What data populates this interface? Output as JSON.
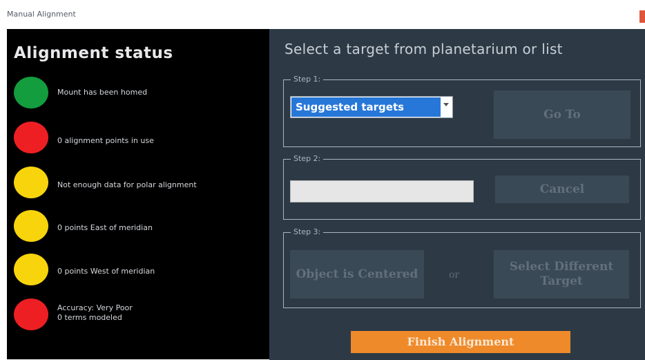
{
  "window": {
    "title": "Manual Alignment"
  },
  "status_panel": {
    "heading": "Alignment status",
    "items": [
      {
        "color": "#139d3f",
        "text": "Mount has been homed"
      },
      {
        "color": "#ee1f23",
        "text": "0 alignment points in use"
      },
      {
        "color": "#f7d40c",
        "text": "Not enough data for polar alignment"
      },
      {
        "color": "#f7d40c",
        "text": "0 points East of meridian"
      },
      {
        "color": "#f7d40c",
        "text": "0 points West of meridian"
      },
      {
        "color": "#ee1f23",
        "text": "Accuracy: Very Poor\n0 terms modeled"
      }
    ]
  },
  "target_panel": {
    "instruction": "Select a target from planetarium or list",
    "step1": {
      "legend": "Step 1:",
      "select_value": "Suggested targets",
      "goto_label": "Go To"
    },
    "step2": {
      "legend": "Step 2:",
      "input_value": "",
      "cancel_label": "Cancel"
    },
    "step3": {
      "legend": "Step 3:",
      "centered_label": "Object is Centered",
      "or_label": "or",
      "different_label": "Select Different Target"
    },
    "finish_label": "Finish Alignment"
  },
  "colors": {
    "left_bg": "#000000",
    "right_bg": "#2d3a46",
    "accent_orange": "#ef8a2a",
    "select_highlight": "#2677d8"
  }
}
